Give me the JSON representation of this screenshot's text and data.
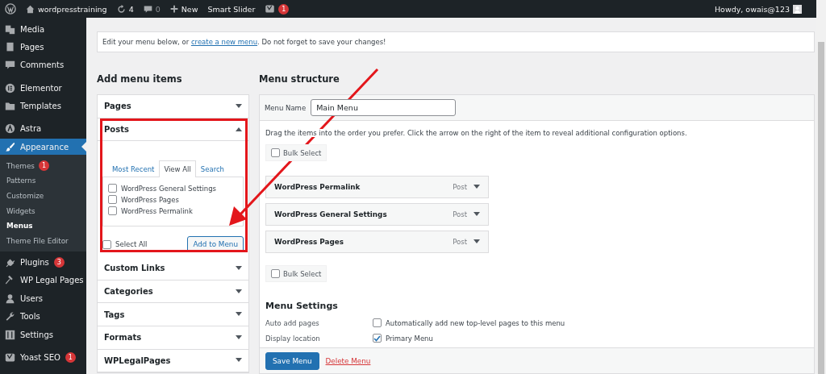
{
  "admin_bar": {
    "site": "wordpresstraining",
    "updates": "4",
    "comments": "0",
    "new": "New",
    "plugin": "Smart Slider",
    "seo_badge": "1",
    "greeting": "Howdy, owais@123"
  },
  "sidebar": {
    "groups": [
      {
        "items": [
          {
            "label": "Media",
            "selected": false
          },
          {
            "label": "Pages",
            "selected": false
          },
          {
            "label": "Comments",
            "selected": false
          }
        ]
      },
      {
        "items": [
          {
            "label": "Elementor",
            "selected": false
          },
          {
            "label": "Templates",
            "selected": false
          }
        ]
      },
      {
        "items": [
          {
            "label": "Astra",
            "selected": false
          },
          {
            "label": "Appearance",
            "selected": true,
            "expanded": true,
            "children": [
              {
                "label": "Themes",
                "badge": "1",
                "selected": false
              },
              {
                "label": "Patterns",
                "selected": false
              },
              {
                "label": "Customize",
                "selected": false
              },
              {
                "label": "Widgets",
                "selected": false
              },
              {
                "label": "Menus",
                "selected": true
              },
              {
                "label": "Theme File Editor",
                "selected": false
              }
            ]
          },
          {
            "label": "Plugins",
            "badge": "3",
            "selected": false
          },
          {
            "label": "WP Legal Pages",
            "selected": false
          },
          {
            "label": "Users",
            "selected": false
          },
          {
            "label": "Tools",
            "selected": false
          },
          {
            "label": "Settings",
            "selected": false
          }
        ]
      },
      {
        "items": [
          {
            "label": "Yoast SEO",
            "badge": "1",
            "selected": false
          }
        ]
      }
    ]
  },
  "notice": {
    "before": "Edit your menu below, or ",
    "link": "create a new menu",
    "after": ". Do not forget to save your changes!"
  },
  "add_menu_items": {
    "title": "Add menu items",
    "sections": [
      {
        "title": "Pages",
        "expanded": false
      },
      {
        "title": "Posts",
        "expanded": true,
        "tabs": [
          {
            "label": "Most Recent",
            "selected": false
          },
          {
            "label": "View All",
            "selected": true
          },
          {
            "label": "Search",
            "selected": false
          }
        ],
        "items": [
          {
            "label": "WordPress General Settings",
            "checked": false
          },
          {
            "label": "WordPress Pages",
            "checked": false
          },
          {
            "label": "WordPress Permalink",
            "checked": false
          }
        ],
        "select_all": {
          "label": "Select All",
          "checked": false
        },
        "button": "Add to Menu"
      },
      {
        "title": "Custom Links",
        "expanded": false
      },
      {
        "title": "Categories",
        "expanded": false
      },
      {
        "title": "Tags",
        "expanded": false
      },
      {
        "title": "Formats",
        "expanded": false
      },
      {
        "title": "WPLegalPages",
        "expanded": false
      }
    ]
  },
  "menu_structure": {
    "title": "Menu structure",
    "name_label": "Menu Name",
    "name": "Main Menu",
    "instructions": "Drag the items into the order you prefer. Click the arrow on the right of the item to reveal additional configuration options.",
    "bulk_select_top": {
      "label": "Bulk Select",
      "checked": false
    },
    "items": [
      {
        "title": "WordPress Permalink",
        "type": "Post"
      },
      {
        "title": "WordPress General Settings",
        "type": "Post"
      },
      {
        "title": "WordPress Pages",
        "type": "Post"
      }
    ],
    "bulk_select_bottom": {
      "label": "Bulk Select",
      "checked": false
    },
    "settings": {
      "title": "Menu Settings",
      "rows": [
        {
          "label": "Auto add pages",
          "option": "Automatically add new top-level pages to this menu",
          "checked": false
        },
        {
          "label": "Display location",
          "option": "Primary Menu",
          "checked": true
        }
      ]
    },
    "save": "Save Menu",
    "delete": "Delete Menu"
  }
}
